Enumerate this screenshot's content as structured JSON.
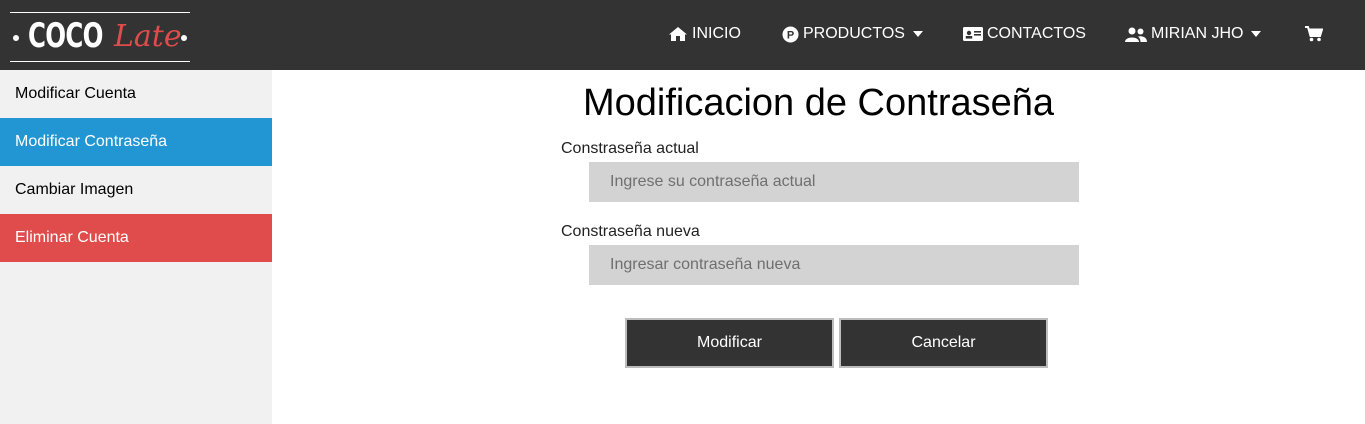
{
  "brand": {
    "logo_left": "COCO",
    "logo_right": "Late",
    "accent_color": "#e04c4c"
  },
  "nav": {
    "inicio": "INICIO",
    "productos": "PRODUCTOS",
    "productos_badge": "P",
    "contactos": "CONTACTOS",
    "user": "MIRIAN JHO",
    "cart_icon": "cart-icon"
  },
  "sidebar": {
    "items": [
      {
        "label": "Modificar Cuenta"
      },
      {
        "label": "Modificar Contraseña",
        "state": "active",
        "color": "#2196d3"
      },
      {
        "label": "Cambiar Imagen"
      },
      {
        "label": "Eliminar Cuenta",
        "state": "danger",
        "color": "#e04c4c"
      }
    ]
  },
  "form": {
    "title": "Modificacion de Contraseña",
    "current_label": "Constraseña actual",
    "current_placeholder": "Ingrese su contraseña actual",
    "current_value": "",
    "new_label": "Constraseña nueva",
    "new_placeholder": "Ingresar contraseña nueva",
    "new_value": "",
    "submit_label": "Modificar",
    "cancel_label": "Cancelar"
  }
}
